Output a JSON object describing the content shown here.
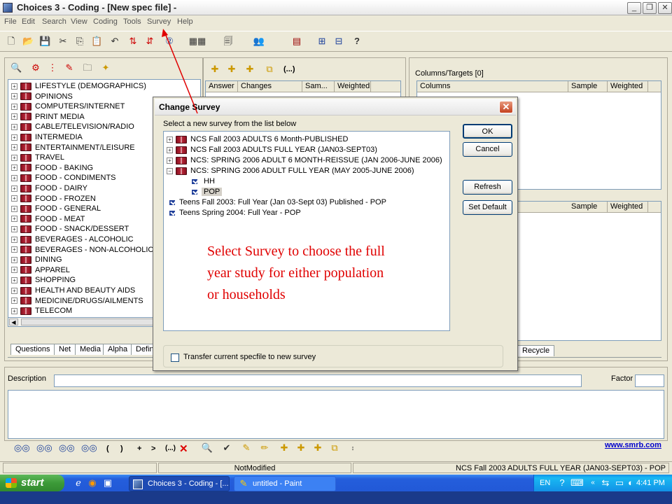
{
  "window": {
    "title": "Choices 3 - Coding - [New spec file] -"
  },
  "window_controls": {
    "minimize": "_",
    "restore": "❐",
    "close": "✕"
  },
  "menu": [
    "File",
    "Edit",
    "Search",
    "View",
    "Coding",
    "Tools",
    "Survey",
    "Help"
  ],
  "toolbar_icons": [
    "new-file-icon",
    "open-folder-icon",
    "save-icon",
    "cut-icon",
    "copy-icon",
    "paste-icon",
    "undo-icon",
    "add-spec-icon",
    "remove-spec-icon",
    "survey-info-icon",
    "grid-icon",
    "preview-icon",
    "people-icon",
    "spreadsheet-icon",
    "layout-icon",
    "layout-alt-icon",
    "help-icon"
  ],
  "left_toolbar_icons": [
    "binoculars-icon",
    "filter-icon",
    "tree-icon",
    "document-icon",
    "folder-icon",
    "wand-icon"
  ],
  "answer_toolbar_icons": [
    "add-answer-icon",
    "add-answer-alt-icon",
    "add-answer-edit-icon",
    "copy-answer-icon",
    "expression-icon"
  ],
  "expression_label": "(...)",
  "categories": [
    "LIFESTYLE (DEMOGRAPHICS)",
    "OPINIONS",
    "COMPUTERS/INTERNET",
    "PRINT MEDIA",
    "CABLE/TELEVISION/RADIO",
    "INTERMEDIA",
    "ENTERTAINMENT/LEISURE",
    "TRAVEL",
    "FOOD - BAKING",
    "FOOD - CONDIMENTS",
    "FOOD - DAIRY",
    "FOOD - FROZEN",
    "FOOD - GENERAL",
    "FOOD - MEAT",
    "FOOD - SNACK/DESSERT",
    "BEVERAGES - ALCOHOLIC",
    "BEVERAGES - NON-ALCOHOLIC",
    "DINING",
    "APPAREL",
    "SHOPPING",
    "HEALTH AND BEAUTY AIDS",
    "MEDICINE/DRUGS/AILMENTS",
    "TELECOM"
  ],
  "answers_table": {
    "columns": [
      "Answer",
      "Changes",
      "Sam...",
      "Weighted"
    ]
  },
  "columns_targets": {
    "label": "Columns/Targets [0]",
    "columns": [
      "Columns",
      "Sample",
      "Weighted"
    ]
  },
  "rows_table": {
    "columns": [
      "Sample",
      "Weighted"
    ]
  },
  "bottom_tabs": [
    "Questions",
    "Net",
    "Media",
    "Alpha",
    "Definiti"
  ],
  "recycle_tab": "Recycle",
  "description": {
    "label": "Description",
    "factor_label": "Factor",
    "value": "",
    "factor_value": ""
  },
  "expression_bar": {
    "paren_open": "(",
    "paren_close": ")",
    "plus": "+",
    "greater": ">",
    "dots_x": "(...)",
    "x_mark": "✕"
  },
  "website_link": "www.smrb.com",
  "status_bar": {
    "state": "NotModified",
    "survey": "NCS Fall 2003 ADULTS FULL YEAR (JAN03-SEPT03) - POP"
  },
  "dialog": {
    "title": "Change Survey",
    "close": "✕",
    "prompt": "Select a new survey from the list below",
    "surveys": [
      {
        "label": "NCS Fall 2003 ADULTS 6 Month-PUBLISHED",
        "expander": "+"
      },
      {
        "label": "NCS Fall 2003 ADULTS FULL YEAR (JAN03-SEPT03)",
        "expander": "+"
      },
      {
        "label": "NCS:  SPRING 2006 ADULT 6 MONTH-REISSUE (JAN 2006-JUNE 2006)",
        "expander": "+"
      },
      {
        "label": "NCS:  SPRING 2006 ADULT FULL YEAR (MAY 2005-JUNE 2006)",
        "expander": "−"
      }
    ],
    "sub_items": [
      "HH",
      "POP"
    ],
    "teen_surveys": [
      "Teens Fall 2003: Full Year (Jan 03-Sept 03) Published -  POP",
      "Teens Spring 2004: Full Year -  POP"
    ],
    "buttons": {
      "ok": "OK",
      "cancel": "Cancel",
      "refresh": "Refresh",
      "set_default": "Set Default"
    },
    "transfer_checkbox": "Transfer current specfile to new survey",
    "annotation_lines": [
      "Select Survey to choose the full",
      "year study for either population",
      "or households"
    ]
  },
  "taskbar": {
    "start": "start",
    "items": [
      "Choices 3 - Coding - [...",
      "untitled - Paint"
    ],
    "lang": "EN",
    "time": "4:41 PM"
  },
  "colors": {
    "annotation": "#e00000",
    "arrow": "#e00000",
    "link": "#0000cc",
    "taskbar": "#245edc"
  }
}
